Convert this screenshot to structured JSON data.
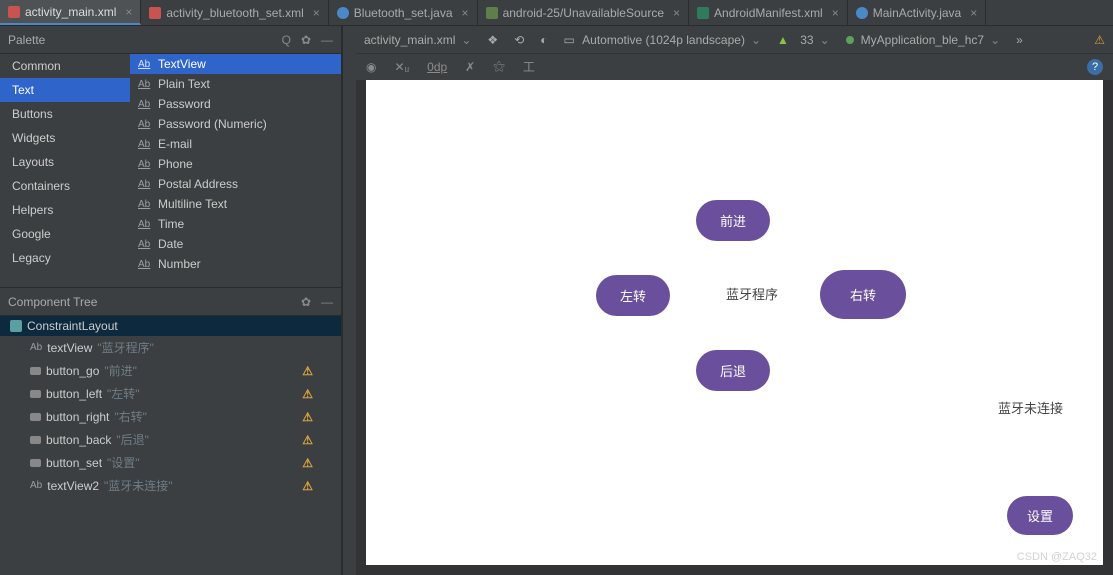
{
  "tabs": [
    {
      "label": "activity_main.xml",
      "icon": "fi-xml",
      "active": true
    },
    {
      "label": "activity_bluetooth_set.xml",
      "icon": "fi-xml"
    },
    {
      "label": "Bluetooth_set.java",
      "icon": "fi-java"
    },
    {
      "label": "android-25/UnavailableSource",
      "icon": "fi-src"
    },
    {
      "label": "AndroidManifest.xml",
      "icon": "fi-mf"
    },
    {
      "label": "MainActivity.java",
      "icon": "fi-java"
    }
  ],
  "palette": {
    "title": "Palette",
    "categories": [
      "Common",
      "Text",
      "Buttons",
      "Widgets",
      "Layouts",
      "Containers",
      "Helpers",
      "Google",
      "Legacy"
    ],
    "selectedCategory": "Text",
    "items": [
      "TextView",
      "Plain Text",
      "Password",
      "Password (Numeric)",
      "E-mail",
      "Phone",
      "Postal Address",
      "Multiline Text",
      "Time",
      "Date",
      "Number"
    ],
    "selectedItem": "TextView"
  },
  "componentTree": {
    "title": "Component Tree",
    "root": "ConstraintLayout",
    "children": [
      {
        "name": "textView",
        "sub": "\"蓝牙程序\"",
        "icon": "text",
        "warn": false
      },
      {
        "name": "button_go",
        "sub": "\"前进\"",
        "icon": "btn",
        "warn": true
      },
      {
        "name": "button_left",
        "sub": "\"左转\"",
        "icon": "btn",
        "warn": true
      },
      {
        "name": "button_right",
        "sub": "\"右转\"",
        "icon": "btn",
        "warn": true
      },
      {
        "name": "button_back",
        "sub": "\"后退\"",
        "icon": "btn",
        "warn": true
      },
      {
        "name": "button_set",
        "sub": "\"设置\"",
        "icon": "btn",
        "warn": true
      },
      {
        "name": "textView2",
        "sub": "\"蓝牙未连接\"",
        "icon": "text",
        "warn": true
      }
    ]
  },
  "designBar": {
    "file": "activity_main.xml",
    "device": "Automotive (1024p landscape)",
    "api": "33",
    "theme": "MyApplication_ble_hc7"
  },
  "subbar": {
    "zoom": "0dp"
  },
  "preview": {
    "title": "蓝牙程序",
    "btn_go": "前进",
    "btn_left": "左转",
    "btn_right": "右转",
    "btn_back": "后退",
    "btn_set": "设置",
    "status": "蓝牙未连接"
  },
  "credit": "CSDN @ZAQ32"
}
